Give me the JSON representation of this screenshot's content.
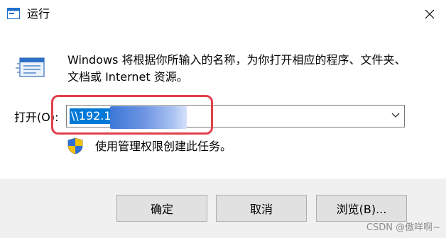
{
  "window": {
    "title": "运行",
    "close_icon": "close-icon"
  },
  "main": {
    "description": "Windows 将根据你所输入的名称，为你打开相应的程序、文件夹、文档或 Internet 资源。",
    "open_label": "打开(O):",
    "open_value": "\\\\192.1",
    "admin_note": "使用管理权限创建此任务。"
  },
  "buttons": {
    "ok": "确定",
    "cancel": "取消",
    "browse": "浏览(B)..."
  },
  "watermark": "CSDN @傲咩啊~",
  "colors": {
    "selection": "#0078d7",
    "highlight_box": "#e0404b",
    "footer_bg": "#f0f0f0"
  }
}
